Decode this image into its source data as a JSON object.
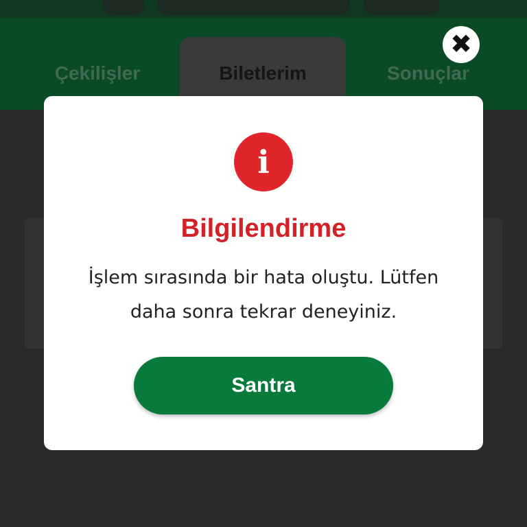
{
  "tabs": [
    {
      "label": "Çekilişler"
    },
    {
      "label": "Biletlerim"
    },
    {
      "label": "Sonuçlar"
    }
  ],
  "dialog": {
    "icon": "info-icon",
    "title": "Bilgilendirme",
    "message": "İşlem sırasında bir hata oluştu. Lütfen daha sonra tekrar deneyiniz.",
    "button_label": "Santra",
    "close_icon": "close-icon"
  },
  "colors": {
    "header_bg": "#0a4a24",
    "title_red": "#d42027",
    "button_green": "#087a3c",
    "icon_red": "#e0262a"
  }
}
